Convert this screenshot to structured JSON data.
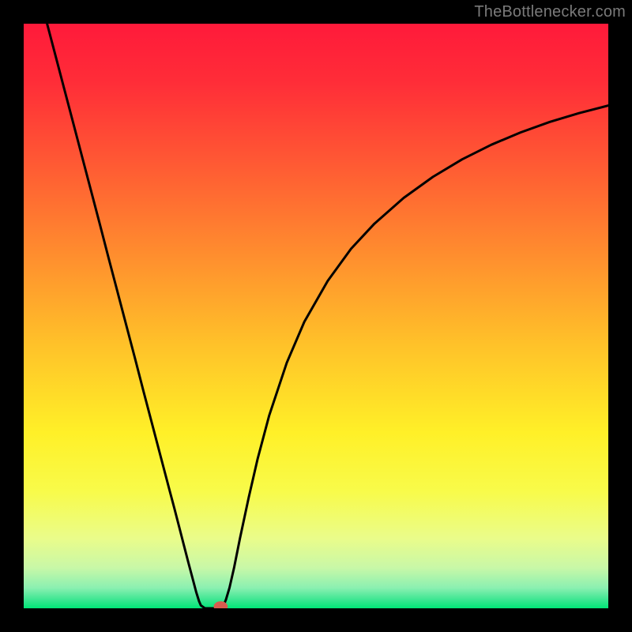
{
  "attribution": "TheBottlenecker.com",
  "chart_data": {
    "type": "line",
    "title": "",
    "xlabel": "",
    "ylabel": "",
    "xlim": [
      0,
      1
    ],
    "ylim": [
      0,
      1
    ],
    "gradient_stops": [
      {
        "offset": 0.0,
        "color": "#ff1a3a"
      },
      {
        "offset": 0.1,
        "color": "#ff2d38"
      },
      {
        "offset": 0.25,
        "color": "#ff5d33"
      },
      {
        "offset": 0.4,
        "color": "#ff8f2e"
      },
      {
        "offset": 0.55,
        "color": "#ffc229"
      },
      {
        "offset": 0.7,
        "color": "#fff028"
      },
      {
        "offset": 0.8,
        "color": "#f8fb4a"
      },
      {
        "offset": 0.88,
        "color": "#eafc8a"
      },
      {
        "offset": 0.93,
        "color": "#c9f8a7"
      },
      {
        "offset": 0.965,
        "color": "#8bf0b1"
      },
      {
        "offset": 0.985,
        "color": "#3de692"
      },
      {
        "offset": 1.0,
        "color": "#00e676"
      }
    ],
    "series": [
      {
        "name": "bottleneck-curve",
        "x": [
          0.04,
          0.055,
          0.07,
          0.085,
          0.1,
          0.115,
          0.13,
          0.145,
          0.16,
          0.175,
          0.19,
          0.205,
          0.22,
          0.235,
          0.25,
          0.258,
          0.266,
          0.274,
          0.282,
          0.29,
          0.295,
          0.3,
          0.303,
          0.31,
          0.322,
          0.338,
          0.342,
          0.346,
          0.352,
          0.36,
          0.37,
          0.385,
          0.4,
          0.42,
          0.45,
          0.48,
          0.52,
          0.56,
          0.6,
          0.65,
          0.7,
          0.75,
          0.8,
          0.85,
          0.9,
          0.95,
          1.0
        ],
        "y": [
          1.0,
          0.943,
          0.886,
          0.829,
          0.772,
          0.715,
          0.658,
          0.6,
          0.543,
          0.486,
          0.429,
          0.371,
          0.314,
          0.257,
          0.2,
          0.17,
          0.139,
          0.108,
          0.077,
          0.047,
          0.028,
          0.012,
          0.005,
          0.0,
          0.0,
          0.0,
          0.005,
          0.015,
          0.035,
          0.07,
          0.12,
          0.19,
          0.255,
          0.33,
          0.42,
          0.49,
          0.56,
          0.615,
          0.658,
          0.702,
          0.738,
          0.768,
          0.793,
          0.814,
          0.832,
          0.847,
          0.86
        ]
      }
    ],
    "marker": {
      "x": 0.337,
      "y": 0.003,
      "rx": 0.012,
      "ry": 0.009,
      "color": "#d85c4f"
    }
  }
}
